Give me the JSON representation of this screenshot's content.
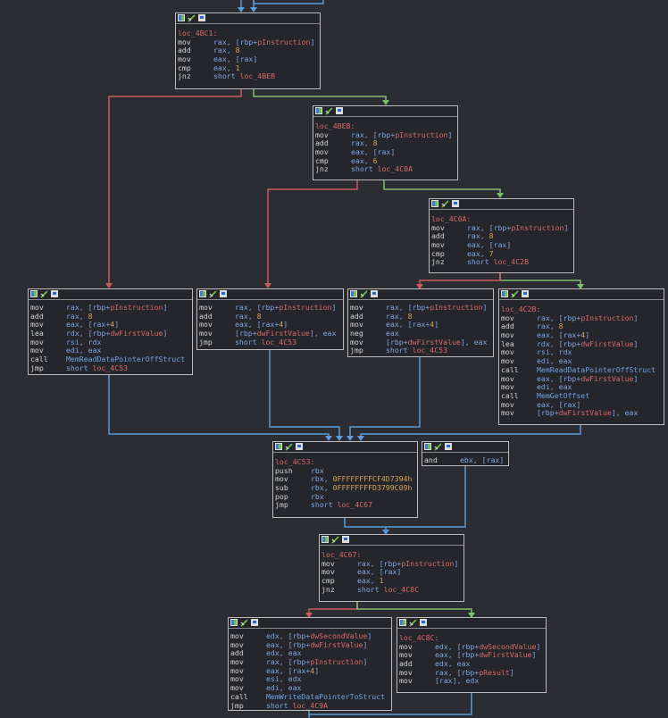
{
  "colors": {
    "background": "#2b2d33",
    "node_bg": "#25262b",
    "edge_true": "#7fbf6f",
    "edge_false": "#c85c5c",
    "edge_jump": "#5c9bd8",
    "label": "#d96a6a"
  },
  "icons": [
    "graph-color-icon",
    "rename-icon",
    "list-view-icon"
  ],
  "nodes": [
    {
      "id": "n1",
      "label": "loc_4BC1:",
      "lines": [
        {
          "m": "mov",
          "o": [
            [
              "reg",
              "rax, ["
            ],
            [
              "reg",
              "rbp"
            ],
            [
              "op",
              "+"
            ],
            [
              "var",
              "pInstruction"
            ],
            [
              "op",
              "]"
            ]
          ]
        },
        {
          "m": "add",
          "o": [
            [
              "reg",
              "rax, "
            ],
            [
              "num",
              "8"
            ]
          ]
        },
        {
          "m": "mov",
          "o": [
            [
              "reg",
              "eax, [rax]"
            ]
          ]
        },
        {
          "m": "cmp",
          "o": [
            [
              "reg",
              "eax, "
            ],
            [
              "num",
              "1"
            ]
          ]
        },
        {
          "m": "jnz",
          "o": [
            [
              "op",
              "short "
            ],
            [
              "var",
              "loc_4BEB"
            ]
          ]
        }
      ]
    },
    {
      "id": "n2",
      "label": "loc_4BEB:",
      "lines": [
        {
          "m": "mov",
          "o": [
            [
              "reg",
              "rax, ["
            ],
            [
              "reg",
              "rbp"
            ],
            [
              "op",
              "+"
            ],
            [
              "var",
              "pInstruction"
            ],
            [
              "op",
              "]"
            ]
          ]
        },
        {
          "m": "add",
          "o": [
            [
              "reg",
              "rax, "
            ],
            [
              "num",
              "8"
            ]
          ]
        },
        {
          "m": "mov",
          "o": [
            [
              "reg",
              "eax, [rax]"
            ]
          ]
        },
        {
          "m": "cmp",
          "o": [
            [
              "reg",
              "eax, "
            ],
            [
              "num",
              "6"
            ]
          ]
        },
        {
          "m": "jnz",
          "o": [
            [
              "op",
              "short "
            ],
            [
              "var",
              "loc_4C0A"
            ]
          ]
        }
      ]
    },
    {
      "id": "n3",
      "label": "loc_4C0A:",
      "lines": [
        {
          "m": "mov",
          "o": [
            [
              "reg",
              "rax, ["
            ],
            [
              "reg",
              "rbp"
            ],
            [
              "op",
              "+"
            ],
            [
              "var",
              "pInstruction"
            ],
            [
              "op",
              "]"
            ]
          ]
        },
        {
          "m": "add",
          "o": [
            [
              "reg",
              "rax, "
            ],
            [
              "num",
              "8"
            ]
          ]
        },
        {
          "m": "mov",
          "o": [
            [
              "reg",
              "eax, [rax]"
            ]
          ]
        },
        {
          "m": "cmp",
          "o": [
            [
              "reg",
              "eax, "
            ],
            [
              "num",
              "7"
            ]
          ]
        },
        {
          "m": "jnz",
          "o": [
            [
              "op",
              "short "
            ],
            [
              "var",
              "loc_4C2B"
            ]
          ]
        }
      ]
    },
    {
      "id": "n4",
      "label": "",
      "lines": [
        {
          "m": "mov",
          "o": [
            [
              "reg",
              "rax, ["
            ],
            [
              "reg",
              "rbp"
            ],
            [
              "op",
              "+"
            ],
            [
              "var",
              "pInstruction"
            ],
            [
              "op",
              "]"
            ]
          ]
        },
        {
          "m": "add",
          "o": [
            [
              "reg",
              "rax, "
            ],
            [
              "num",
              "8"
            ]
          ]
        },
        {
          "m": "mov",
          "o": [
            [
              "reg",
              "eax, [rax+"
            ],
            [
              "num",
              "4"
            ],
            [
              "reg",
              "]"
            ]
          ]
        },
        {
          "m": "lea",
          "o": [
            [
              "reg",
              "rdx, ["
            ],
            [
              "reg",
              "rbp"
            ],
            [
              "op",
              "+"
            ],
            [
              "var",
              "dwFirstValue"
            ],
            [
              "op",
              "]"
            ]
          ]
        },
        {
          "m": "mov",
          "o": [
            [
              "reg",
              "rsi, rdx"
            ]
          ]
        },
        {
          "m": "mov",
          "o": [
            [
              "reg",
              "edi, eax"
            ]
          ]
        },
        {
          "m": "call",
          "o": [
            [
              "fn",
              "MemReadDataPointerOffStruct"
            ]
          ]
        },
        {
          "m": "jmp",
          "o": [
            [
              "op",
              "short "
            ],
            [
              "var",
              "loc_4C53"
            ]
          ]
        }
      ]
    },
    {
      "id": "n5",
      "label": "",
      "lines": [
        {
          "m": "mov",
          "o": [
            [
              "reg",
              "rax, ["
            ],
            [
              "reg",
              "rbp"
            ],
            [
              "op",
              "+"
            ],
            [
              "var",
              "pInstruction"
            ],
            [
              "op",
              "]"
            ]
          ]
        },
        {
          "m": "add",
          "o": [
            [
              "reg",
              "rax, "
            ],
            [
              "num",
              "8"
            ]
          ]
        },
        {
          "m": "mov",
          "o": [
            [
              "reg",
              "eax, [rax+"
            ],
            [
              "num",
              "4"
            ],
            [
              "reg",
              "]"
            ]
          ]
        },
        {
          "m": "mov",
          "o": [
            [
              "reg",
              "["
            ],
            [
              "reg",
              "rbp"
            ],
            [
              "op",
              "+"
            ],
            [
              "var",
              "dwFirstValue"
            ],
            [
              "reg",
              "], eax"
            ]
          ]
        },
        {
          "m": "jmp",
          "o": [
            [
              "op",
              "short "
            ],
            [
              "var",
              "loc_4C53"
            ]
          ]
        }
      ]
    },
    {
      "id": "n6",
      "label": "",
      "lines": [
        {
          "m": "mov",
          "o": [
            [
              "reg",
              "rax, ["
            ],
            [
              "reg",
              "rbp"
            ],
            [
              "op",
              "+"
            ],
            [
              "var",
              "pInstruction"
            ],
            [
              "op",
              "]"
            ]
          ]
        },
        {
          "m": "add",
          "o": [
            [
              "reg",
              "rax, "
            ],
            [
              "num",
              "8"
            ]
          ]
        },
        {
          "m": "mov",
          "o": [
            [
              "reg",
              "eax, [rax+"
            ],
            [
              "num",
              "4"
            ],
            [
              "reg",
              "]"
            ]
          ]
        },
        {
          "m": "neg",
          "o": [
            [
              "reg",
              "eax"
            ]
          ]
        },
        {
          "m": "mov",
          "o": [
            [
              "reg",
              "["
            ],
            [
              "reg",
              "rbp"
            ],
            [
              "op",
              "+"
            ],
            [
              "var",
              "dwFirstValue"
            ],
            [
              "reg",
              "], eax"
            ]
          ]
        },
        {
          "m": "jmp",
          "o": [
            [
              "op",
              "short "
            ],
            [
              "var",
              "loc_4C53"
            ]
          ]
        }
      ]
    },
    {
      "id": "n7",
      "label": "loc_4C2B:",
      "lines": [
        {
          "m": "mov",
          "o": [
            [
              "reg",
              "rax, ["
            ],
            [
              "reg",
              "rbp"
            ],
            [
              "op",
              "+"
            ],
            [
              "var",
              "pInstruction"
            ],
            [
              "op",
              "]"
            ]
          ]
        },
        {
          "m": "add",
          "o": [
            [
              "reg",
              "rax, "
            ],
            [
              "num",
              "8"
            ]
          ]
        },
        {
          "m": "mov",
          "o": [
            [
              "reg",
              "eax, [rax+"
            ],
            [
              "num",
              "4"
            ],
            [
              "reg",
              "]"
            ]
          ]
        },
        {
          "m": "lea",
          "o": [
            [
              "reg",
              "rdx, ["
            ],
            [
              "reg",
              "rbp"
            ],
            [
              "op",
              "+"
            ],
            [
              "var",
              "dwFirstValue"
            ],
            [
              "op",
              "]"
            ]
          ]
        },
        {
          "m": "mov",
          "o": [
            [
              "reg",
              "rsi, rdx"
            ]
          ]
        },
        {
          "m": "mov",
          "o": [
            [
              "reg",
              "edi, eax"
            ]
          ]
        },
        {
          "m": "call",
          "o": [
            [
              "fn",
              "MemReadDataPointerOffStruct"
            ]
          ]
        },
        {
          "m": "mov",
          "o": [
            [
              "reg",
              "eax, ["
            ],
            [
              "reg",
              "rbp"
            ],
            [
              "op",
              "+"
            ],
            [
              "var",
              "dwFirstValue"
            ],
            [
              "op",
              "]"
            ]
          ]
        },
        {
          "m": "mov",
          "o": [
            [
              "reg",
              "edi, eax"
            ]
          ]
        },
        {
          "m": "call",
          "o": [
            [
              "fn",
              "MemGetOffset"
            ]
          ]
        },
        {
          "m": "mov",
          "o": [
            [
              "reg",
              "eax, [rax]"
            ]
          ]
        },
        {
          "m": "mov",
          "o": [
            [
              "reg",
              "["
            ],
            [
              "reg",
              "rbp"
            ],
            [
              "op",
              "+"
            ],
            [
              "var",
              "dwFirstValue"
            ],
            [
              "reg",
              "], eax"
            ]
          ]
        }
      ]
    },
    {
      "id": "n8",
      "label": "loc_4C53:",
      "lines": [
        {
          "m": "push",
          "o": [
            [
              "reg",
              "rbx"
            ]
          ]
        },
        {
          "m": "mov",
          "o": [
            [
              "reg",
              "rbx, "
            ],
            [
              "num",
              "0FFFFFFFFCF4D7394h"
            ]
          ]
        },
        {
          "m": "sub",
          "o": [
            [
              "reg",
              "rbx, "
            ],
            [
              "num",
              "0FFFFFFFFD3799C09h"
            ]
          ]
        },
        {
          "m": "pop",
          "o": [
            [
              "reg",
              "rbx"
            ]
          ]
        },
        {
          "m": "jmp",
          "o": [
            [
              "op",
              "short "
            ],
            [
              "var",
              "loc_4C67"
            ]
          ]
        }
      ]
    },
    {
      "id": "n9",
      "label": "",
      "lines": [
        {
          "m": "and",
          "o": [
            [
              "reg",
              "ebx, [rax]"
            ]
          ]
        }
      ]
    },
    {
      "id": "n10",
      "label": "loc_4C67:",
      "lines": [
        {
          "m": "mov",
          "o": [
            [
              "reg",
              "rax, ["
            ],
            [
              "reg",
              "rbp"
            ],
            [
              "op",
              "+"
            ],
            [
              "var",
              "pInstruction"
            ],
            [
              "op",
              "]"
            ]
          ]
        },
        {
          "m": "mov",
          "o": [
            [
              "reg",
              "eax, [rax]"
            ]
          ]
        },
        {
          "m": "cmp",
          "o": [
            [
              "reg",
              "eax, "
            ],
            [
              "num",
              "1"
            ]
          ]
        },
        {
          "m": "jnz",
          "o": [
            [
              "op",
              "short "
            ],
            [
              "var",
              "loc_4C8C"
            ]
          ]
        }
      ]
    },
    {
      "id": "n11",
      "label": "",
      "lines": [
        {
          "m": "mov",
          "o": [
            [
              "reg",
              "edx, ["
            ],
            [
              "reg",
              "rbp"
            ],
            [
              "op",
              "+"
            ],
            [
              "var",
              "dwSecondValue"
            ],
            [
              "op",
              "]"
            ]
          ]
        },
        {
          "m": "mov",
          "o": [
            [
              "reg",
              "eax, ["
            ],
            [
              "reg",
              "rbp"
            ],
            [
              "op",
              "+"
            ],
            [
              "var",
              "dwFirstValue"
            ],
            [
              "op",
              "]"
            ]
          ]
        },
        {
          "m": "add",
          "o": [
            [
              "reg",
              "edx, eax"
            ]
          ]
        },
        {
          "m": "mov",
          "o": [
            [
              "reg",
              "rax, ["
            ],
            [
              "reg",
              "rbp"
            ],
            [
              "op",
              "+"
            ],
            [
              "var",
              "pInstruction"
            ],
            [
              "op",
              "]"
            ]
          ]
        },
        {
          "m": "mov",
          "o": [
            [
              "reg",
              "eax, [rax+"
            ],
            [
              "num",
              "4"
            ],
            [
              "reg",
              "]"
            ]
          ]
        },
        {
          "m": "mov",
          "o": [
            [
              "reg",
              "esi, edx"
            ]
          ]
        },
        {
          "m": "mov",
          "o": [
            [
              "reg",
              "edi, eax"
            ]
          ]
        },
        {
          "m": "call",
          "o": [
            [
              "fn",
              "MemWriteDataPointerToStruct"
            ]
          ]
        },
        {
          "m": "jmp",
          "o": [
            [
              "op",
              "short "
            ],
            [
              "var",
              "loc_4C9A"
            ]
          ]
        }
      ]
    },
    {
      "id": "n12",
      "label": "loc_4C8C:",
      "lines": [
        {
          "m": "mov",
          "o": [
            [
              "reg",
              "edx, ["
            ],
            [
              "reg",
              "rbp"
            ],
            [
              "op",
              "+"
            ],
            [
              "var",
              "dwSecondValue"
            ],
            [
              "op",
              "]"
            ]
          ]
        },
        {
          "m": "mov",
          "o": [
            [
              "reg",
              "eax, ["
            ],
            [
              "reg",
              "rbp"
            ],
            [
              "op",
              "+"
            ],
            [
              "var",
              "dwFirstValue"
            ],
            [
              "op",
              "]"
            ]
          ]
        },
        {
          "m": "add",
          "o": [
            [
              "reg",
              "edx, eax"
            ]
          ]
        },
        {
          "m": "mov",
          "o": [
            [
              "reg",
              "rax, ["
            ],
            [
              "reg",
              "rbp"
            ],
            [
              "op",
              "+"
            ],
            [
              "var",
              "pResult"
            ],
            [
              "op",
              "]"
            ]
          ]
        },
        {
          "m": "mov",
          "o": [
            [
              "reg",
              "[rax], edx"
            ]
          ]
        }
      ]
    }
  ]
}
